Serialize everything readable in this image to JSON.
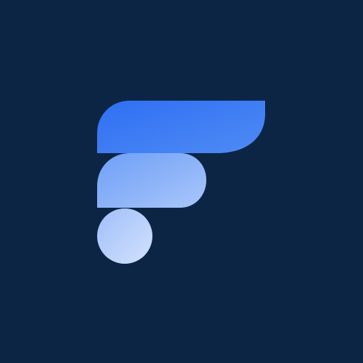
{
  "logo": {
    "icon": "f-letter-logo-icon",
    "colors": {
      "background": "#0D2544",
      "top_bar_start": "#2F6FF2",
      "top_bar_end": "#4F8BF5",
      "middle_bar_start": "#6E9FF7",
      "middle_bar_end": "#A9C6FA",
      "circle_start": "#9FBEF9",
      "circle_end": "#D3E2FD"
    }
  }
}
